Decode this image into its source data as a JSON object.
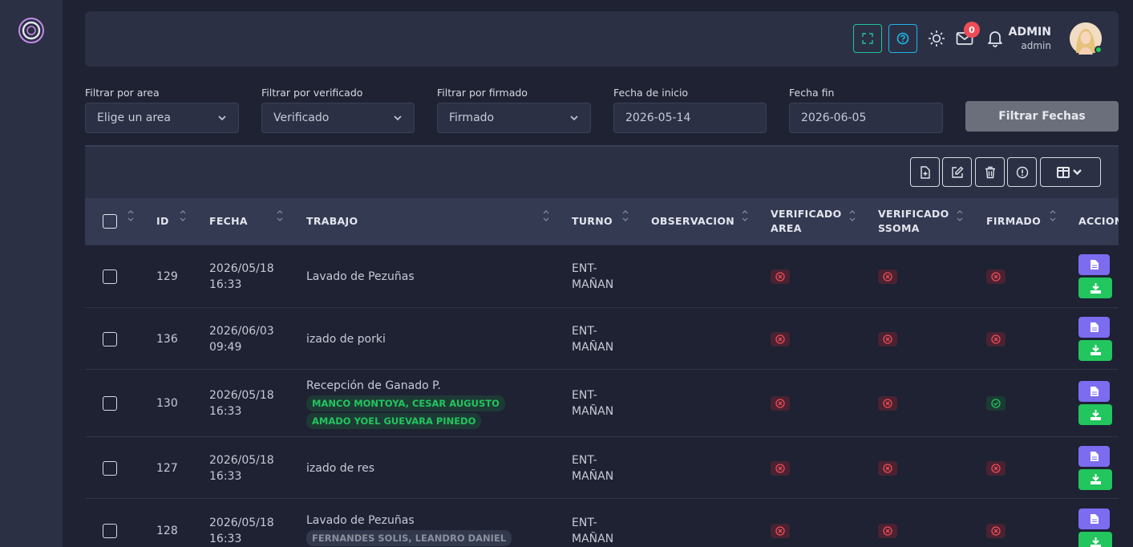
{
  "header": {
    "user_name": "ADMIN",
    "user_role": "admin",
    "mail_count": "0",
    "icons": [
      "expand-icon",
      "help-icon",
      "sun-icon",
      "mail-icon",
      "bell-icon"
    ]
  },
  "filters": {
    "area": {
      "label": "Filtrar por area",
      "value": "Elige un area"
    },
    "verificado": {
      "label": "Filtrar por verificado",
      "value": "Verificado"
    },
    "firmado": {
      "label": "Filtrar por firmado",
      "value": "Firmado"
    },
    "fecha_inicio": {
      "label": "Fecha de inicio",
      "value": "2026-05-14"
    },
    "fecha_fin": {
      "label": "Fecha fin",
      "value": "2026-06-05"
    },
    "button": "Filtrar Fechas"
  },
  "table": {
    "headers": {
      "id": "ID",
      "fecha": "FECHA",
      "trabajo": "TRABAJO",
      "turno": "TURNO",
      "observacion": "OBSERVACION",
      "verificado_area": [
        "VERIFICADO",
        "AREA"
      ],
      "verificado_ssoma": [
        "VERIFICADO",
        "SSOMA"
      ],
      "firmado": "FIRMADO",
      "acciones": "ACCIONES"
    },
    "rows": [
      {
        "id": "129",
        "fecha": "2026/05/18",
        "hora": "16:33",
        "trabajo": "Lavado de Pezuñas",
        "tags": [],
        "turno": [
          "ENT-",
          "MAÑAN"
        ],
        "v_area": "no",
        "v_ssoma": "no",
        "firmado": "no"
      },
      {
        "id": "136",
        "fecha": "2026/06/03",
        "hora": "09:49",
        "trabajo": "izado de porki",
        "tags": [],
        "turno": [
          "ENT-",
          "MAÑAN"
        ],
        "v_area": "no",
        "v_ssoma": "no",
        "firmado": "no"
      },
      {
        "id": "130",
        "fecha": "2026/05/18",
        "hora": "16:33",
        "trabajo": "Recepción de Ganado P.",
        "tags": [
          {
            "text": "MANCO MONTOYA, CESAR AUGUSTO",
            "color": "green"
          },
          {
            "text": "AMADO YOEL GUEVARA PINEDO",
            "color": "green"
          }
        ],
        "turno": [
          "ENT-",
          "MAÑAN"
        ],
        "v_area": "no",
        "v_ssoma": "no",
        "firmado": "yes"
      },
      {
        "id": "127",
        "fecha": "2026/05/18",
        "hora": "16:33",
        "trabajo": "izado de res",
        "tags": [],
        "turno": [
          "ENT-",
          "MAÑAN"
        ],
        "v_area": "no",
        "v_ssoma": "no",
        "firmado": "no"
      },
      {
        "id": "128",
        "fecha": "2026/05/18",
        "hora": "16:33",
        "trabajo": "Lavado de Pezuñas",
        "tags": [
          {
            "text": "FERNANDES SOLIS, LEANDRO DANIEL",
            "color": "gray"
          }
        ],
        "turno": [
          "ENT-",
          "MAÑAN"
        ],
        "v_area": "no",
        "v_ssoma": "no",
        "firmado": "no"
      }
    ]
  },
  "colors": {
    "accent_green": "#22c55e",
    "accent_purple": "#7c6cf0",
    "danger": "#ef4c58"
  }
}
